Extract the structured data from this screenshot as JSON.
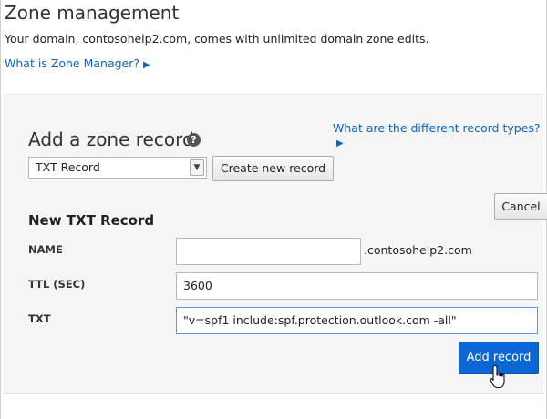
{
  "page": {
    "title": "Zone management",
    "subtitle": "Your domain, contosohelp2.com, comes with unlimited domain zone edits.",
    "zone_manager_link": "What is Zone Manager?",
    "link_arrow_icon": "triangle-right-icon"
  },
  "add_panel": {
    "title": "Add a zone record",
    "help_icon": "question-circle-icon",
    "record_types_link": "What are the different record types?",
    "record_type_select": {
      "value": "TXT Record"
    },
    "create_button": "Create new record",
    "cancel_button": "Cancel"
  },
  "form": {
    "title": "New TXT Record",
    "name_label": "NAME",
    "name_value": "",
    "name_suffix": ".contosohelp2.com",
    "ttl_label": "TTL (SEC)",
    "ttl_value": "3600",
    "txt_label": "TXT",
    "txt_value": "\"v=spf1 include:spf.protection.outlook.com -all\"",
    "add_button": "Add record"
  },
  "colors": {
    "link": "#0a64c2",
    "primary_button": "#0b66d6",
    "panel_background": "#f5f5f5"
  }
}
